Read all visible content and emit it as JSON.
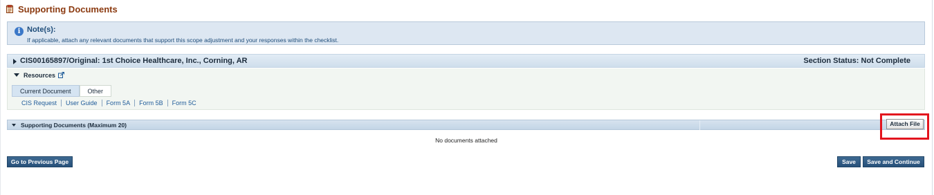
{
  "page": {
    "title": "Supporting Documents",
    "title_icon": "document-icon",
    "colors": {
      "title": "#8b3a10",
      "button": "#2e5a84",
      "highlight": "#e3141e"
    }
  },
  "note": {
    "title": "Note(s):",
    "text": "If applicable, attach any relevant documents that support this scope adjustment and your responses within the checklist.",
    "icon": "info-icon"
  },
  "cis_section": {
    "title": "CIS00165897/Original: 1st Choice Healthcare, Inc., Corning, AR",
    "status": "Section Status: Not Complete"
  },
  "resources": {
    "label": "Resources",
    "tabs": [
      {
        "label": "Current Document",
        "active": true
      },
      {
        "label": "Other",
        "active": false
      }
    ],
    "links": [
      "CIS Request",
      "User Guide",
      "Form 5A",
      "Form 5B",
      "Form 5C"
    ]
  },
  "supporting_documents": {
    "header": "Supporting Documents (Maximum 20)",
    "attach_label": "Attach File",
    "empty_message": "No documents attached"
  },
  "actions": {
    "previous": "Go to Previous Page",
    "save": "Save",
    "save_continue": "Save and Continue"
  }
}
